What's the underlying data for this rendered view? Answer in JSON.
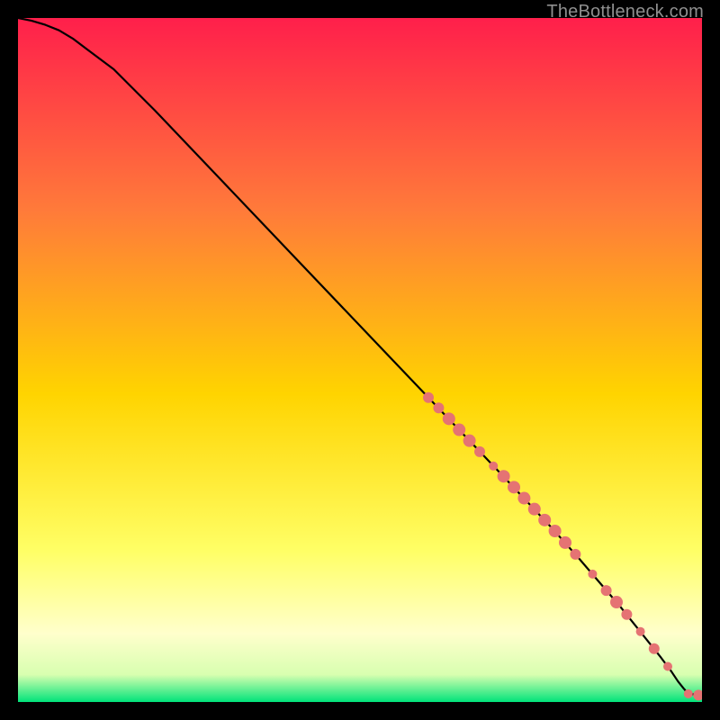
{
  "watermark": "TheBottleneck.com",
  "gradient_colors": {
    "top": "#ff1f4b",
    "upper_mid": "#ff7a3a",
    "mid": "#ffd400",
    "lower_mid": "#ffff66",
    "pale_band": "#ffffcc",
    "pale_green": "#d8ffb0",
    "green": "#00e37a"
  },
  "chart_data": {
    "type": "line",
    "title": "",
    "xlabel": "",
    "ylabel": "",
    "xlim": [
      0,
      100
    ],
    "ylim": [
      0,
      100
    ],
    "series": [
      {
        "name": "curve",
        "x": [
          0,
          2,
          4,
          6,
          8,
          10,
          14,
          20,
          30,
          40,
          50,
          60,
          70,
          78,
          82,
          85,
          88,
          90,
          92,
          94,
          95.5,
          96.5,
          97.3,
          98,
          100
        ],
        "y": [
          100,
          99.6,
          99.0,
          98.2,
          97.0,
          95.5,
          92.5,
          86.5,
          76.0,
          65.5,
          55.0,
          44.5,
          34.0,
          25.5,
          21.0,
          17.5,
          14.0,
          11.5,
          9.0,
          6.5,
          4.5,
          3.0,
          2.0,
          1.2,
          1.0
        ]
      }
    ],
    "markers": {
      "name": "points",
      "color": "#e57373",
      "stroke": "#ba4a4a",
      "items": [
        {
          "x": 60.0,
          "y": 44.5,
          "r": 6
        },
        {
          "x": 61.5,
          "y": 43.0,
          "r": 6
        },
        {
          "x": 63.0,
          "y": 41.4,
          "r": 7
        },
        {
          "x": 64.5,
          "y": 39.8,
          "r": 7
        },
        {
          "x": 66.0,
          "y": 38.2,
          "r": 7
        },
        {
          "x": 67.5,
          "y": 36.6,
          "r": 6
        },
        {
          "x": 69.5,
          "y": 34.5,
          "r": 5
        },
        {
          "x": 71.0,
          "y": 33.0,
          "r": 7
        },
        {
          "x": 72.5,
          "y": 31.4,
          "r": 7
        },
        {
          "x": 74.0,
          "y": 29.8,
          "r": 7
        },
        {
          "x": 75.5,
          "y": 28.2,
          "r": 7
        },
        {
          "x": 77.0,
          "y": 26.6,
          "r": 7
        },
        {
          "x": 78.5,
          "y": 25.0,
          "r": 7
        },
        {
          "x": 80.0,
          "y": 23.3,
          "r": 7
        },
        {
          "x": 81.5,
          "y": 21.6,
          "r": 6
        },
        {
          "x": 84.0,
          "y": 18.7,
          "r": 5
        },
        {
          "x": 86.0,
          "y": 16.3,
          "r": 6
        },
        {
          "x": 87.5,
          "y": 14.6,
          "r": 7
        },
        {
          "x": 89.0,
          "y": 12.8,
          "r": 6
        },
        {
          "x": 91.0,
          "y": 10.3,
          "r": 5
        },
        {
          "x": 93.0,
          "y": 7.8,
          "r": 6
        },
        {
          "x": 95.0,
          "y": 5.2,
          "r": 5
        },
        {
          "x": 98.0,
          "y": 1.2,
          "r": 5
        },
        {
          "x": 99.5,
          "y": 1.0,
          "r": 6
        },
        {
          "x": 100.5,
          "y": 1.0,
          "r": 6
        }
      ]
    }
  }
}
